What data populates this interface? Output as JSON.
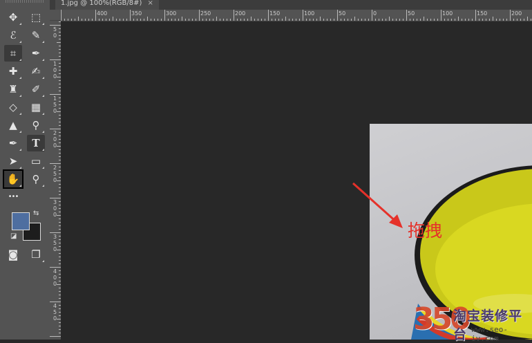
{
  "document_tab": {
    "title": "1.jpg @ 100%(RGB/8#)",
    "close_glyph": "×"
  },
  "ruler": {
    "horizontal": [
      "400",
      "350",
      "300",
      "250",
      "200",
      "150",
      "100",
      "50",
      "0",
      "50",
      "100",
      "150",
      "200"
    ],
    "vertical": [
      "5\n0",
      "1\n0\n0",
      "1\n5\n0",
      "2\n0\n0",
      "2\n5\n0",
      "3\n0\n0",
      "3\n5\n0",
      "4\n0\n0",
      "4\n5\n0"
    ]
  },
  "tools": [
    {
      "icon": "move-icon",
      "glyph": "✥"
    },
    {
      "icon": "marquee-icon",
      "glyph": "⬚"
    },
    {
      "icon": "lasso-icon",
      "glyph": "ℰ"
    },
    {
      "icon": "quick-selection-icon",
      "glyph": "✎"
    },
    {
      "icon": "crop-icon",
      "glyph": "⌗"
    },
    {
      "icon": "eyedropper-icon",
      "glyph": "✒"
    },
    {
      "icon": "healing-brush-icon",
      "glyph": "✚"
    },
    {
      "icon": "brush-icon",
      "glyph": "✍"
    },
    {
      "icon": "clone-stamp-icon",
      "glyph": "♜"
    },
    {
      "icon": "history-brush-icon",
      "glyph": "✐"
    },
    {
      "icon": "eraser-icon",
      "glyph": "◇"
    },
    {
      "icon": "gradient-icon",
      "glyph": "▦"
    },
    {
      "icon": "blur-icon",
      "glyph": "▲"
    },
    {
      "icon": "dodge-icon",
      "glyph": "⚲"
    },
    {
      "icon": "pen-icon",
      "glyph": "✒"
    },
    {
      "icon": "type-icon",
      "glyph": "T"
    },
    {
      "icon": "path-selection-icon",
      "glyph": "➤"
    },
    {
      "icon": "rectangle-icon",
      "glyph": "▭"
    },
    {
      "icon": "hand-icon",
      "glyph": "✋"
    },
    {
      "icon": "zoom-icon",
      "glyph": "⚲"
    },
    {
      "icon": "more-tools-icon",
      "glyph": "•••"
    },
    {
      "icon": "quick-mask-icon",
      "glyph": "◙"
    },
    {
      "icon": "screen-mode-icon",
      "glyph": "❐"
    }
  ],
  "colors": {
    "foreground": "#4e6ea0",
    "background": "#1d1d1d",
    "swap_glyph": "⇆",
    "default_glyph": "◪"
  },
  "annotation": {
    "label": "拖拽",
    "color": "#e5312a"
  },
  "watermark": {
    "number": "350",
    "brand": "淘宝装修平台",
    "url": "www.seo-iv.com"
  }
}
